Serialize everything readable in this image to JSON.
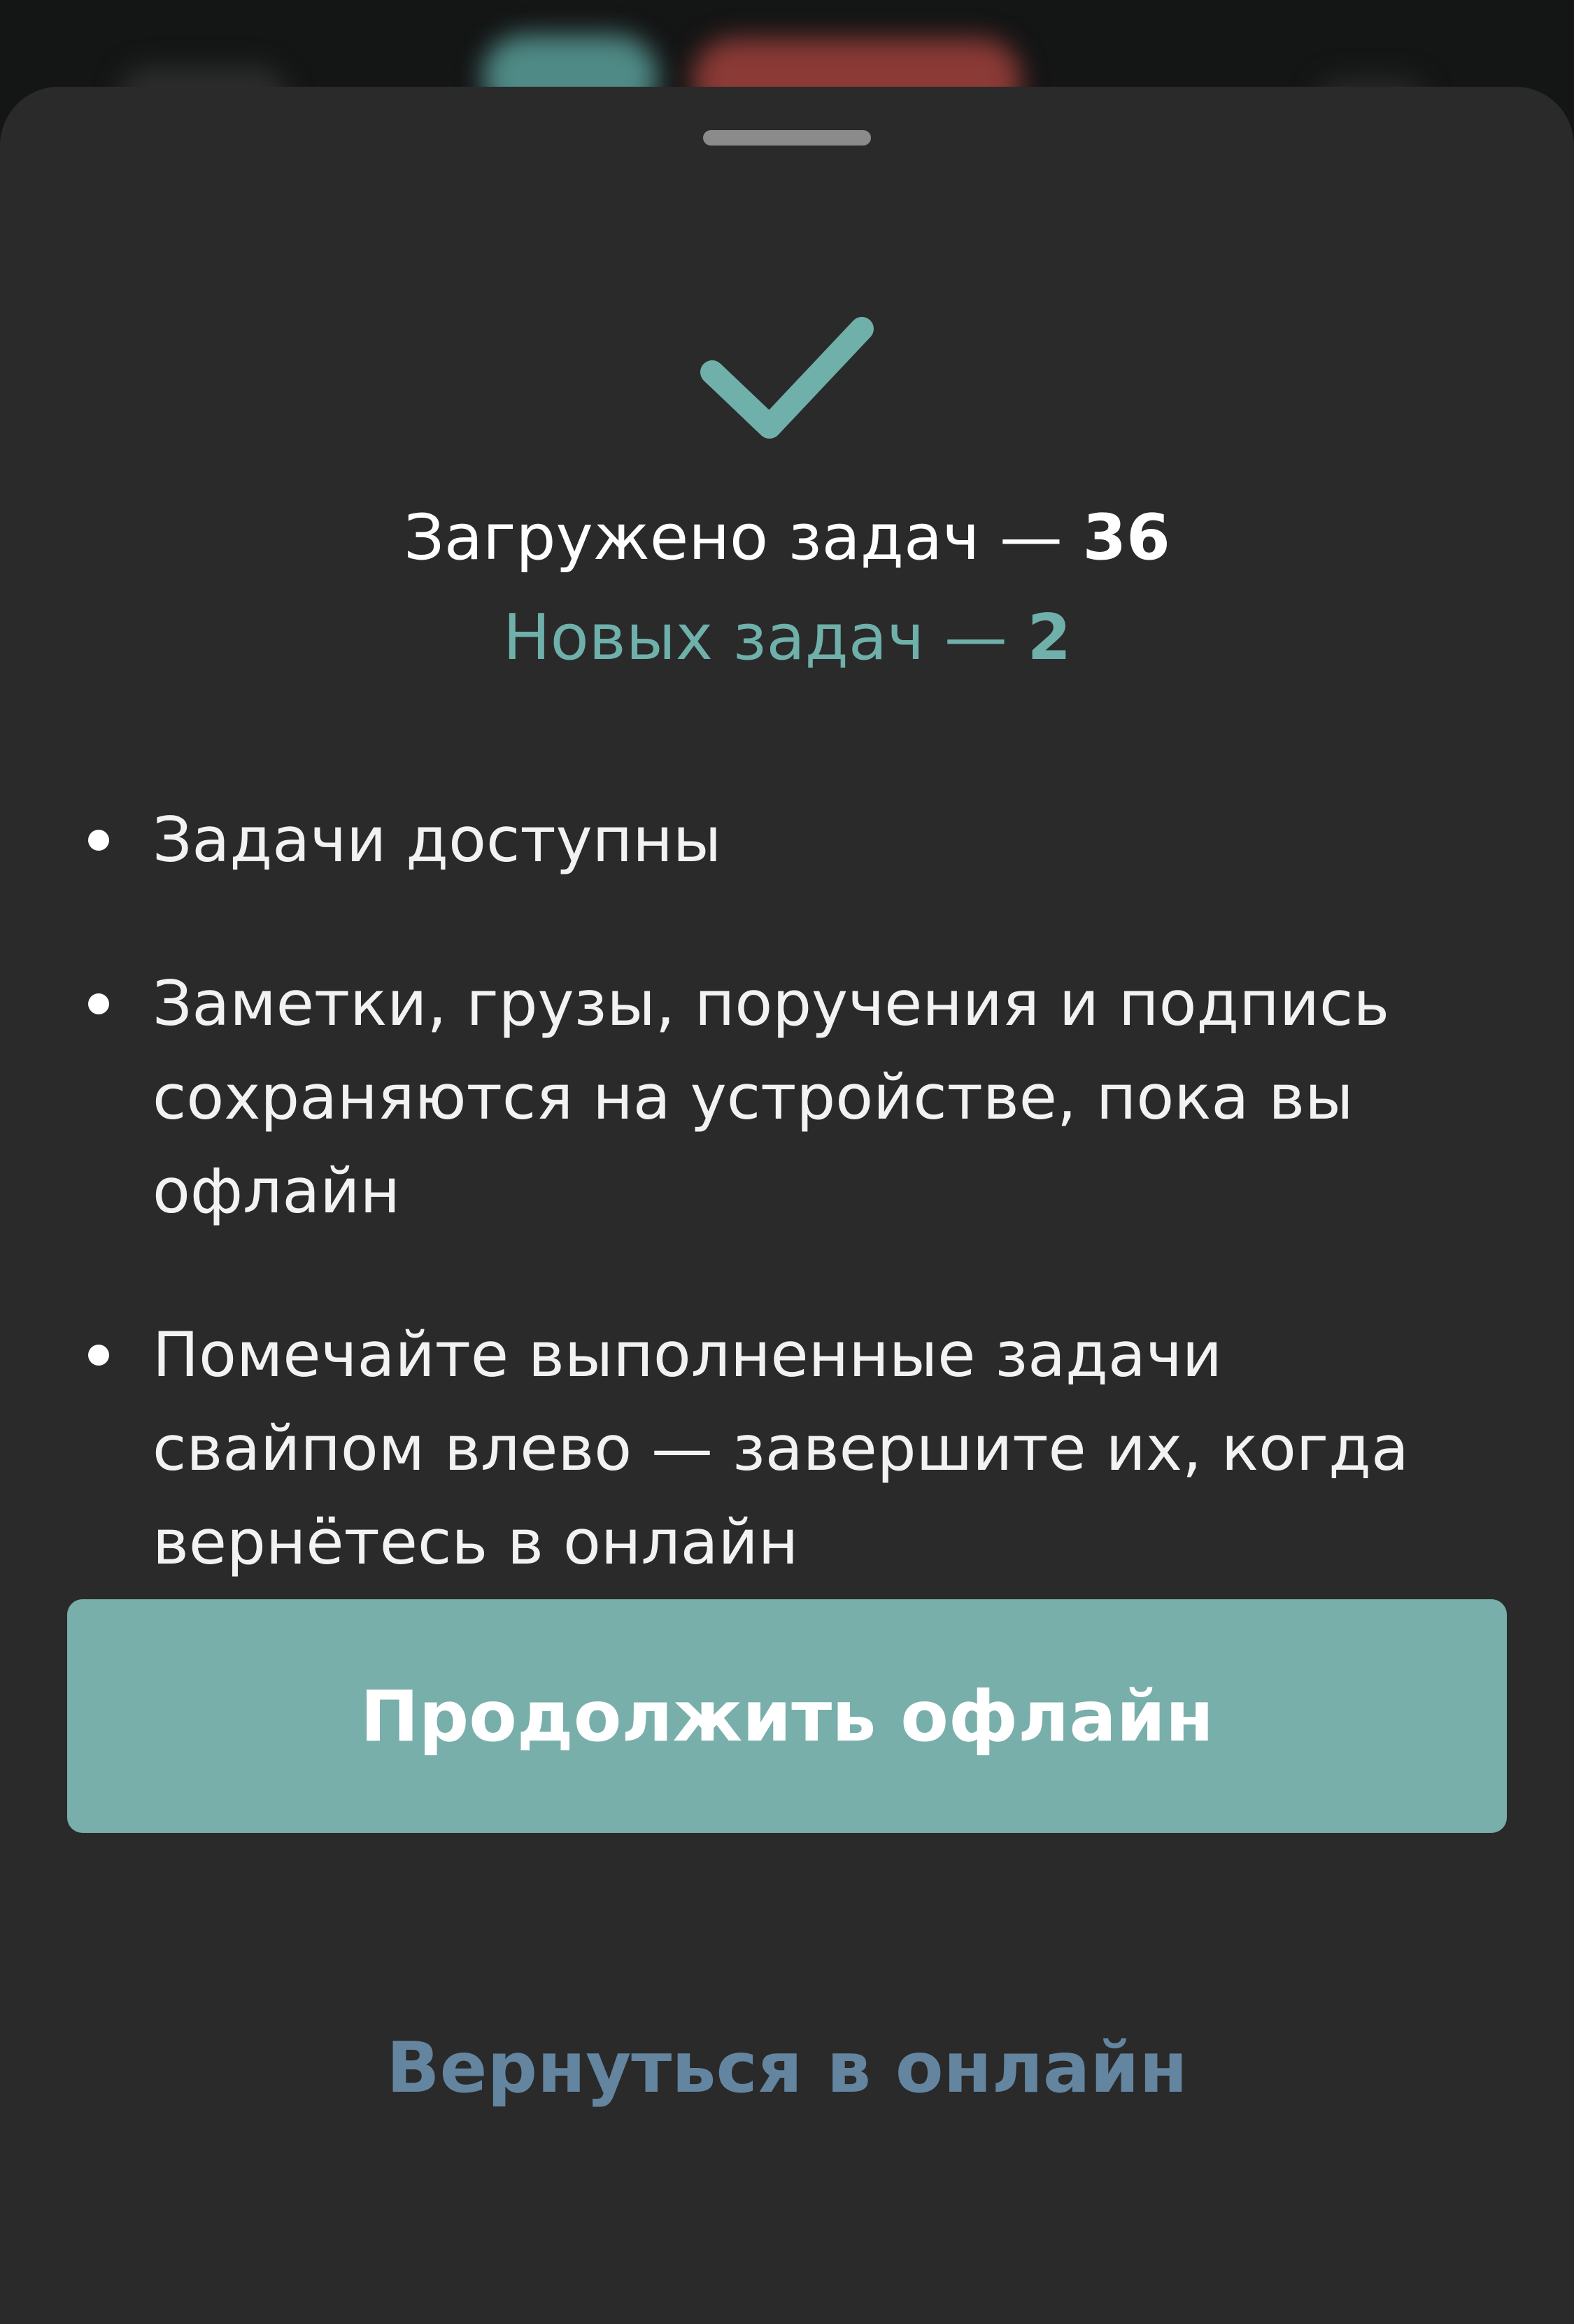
{
  "summary": {
    "loaded_label": "Загружено задач — ",
    "loaded_count": "36",
    "new_label": "Новых задач — ",
    "new_count": "2"
  },
  "info_items": [
    {
      "text": "Задачи доступны"
    },
    {
      "text": "Заметки, грузы, поручения и подпись сохраняются на устройстве, пока вы офлайн"
    },
    {
      "text": "Помечайте выполненные задачи свайпом влево — завершите их, когда вернётесь в онлайн"
    }
  ],
  "actions": {
    "continue_offline": "Продолжить офлайн",
    "return_online": "Вернуться в онлайн"
  },
  "colors": {
    "sheet_background": "#2a2a2a",
    "accent_teal": "#78afaa",
    "new_tasks_text": "#6fb0aa",
    "secondary_action": "#6485a0",
    "check_icon": "#6fb0aa"
  },
  "icons": {
    "status": "checkmark-icon",
    "bullet": "bullet-dot"
  }
}
